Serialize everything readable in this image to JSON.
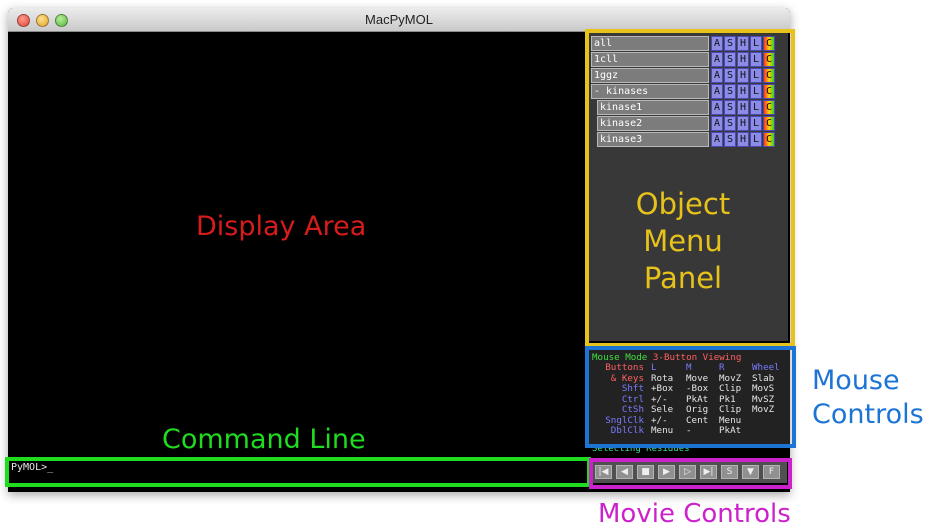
{
  "window": {
    "title": "MacPyMOL"
  },
  "objects": [
    {
      "name": "all",
      "indent": 0
    },
    {
      "name": "1cll",
      "indent": 0
    },
    {
      "name": "1ggz",
      "indent": 0
    },
    {
      "name": "- kinases",
      "indent": 0
    },
    {
      "name": "kinase1",
      "indent": 1
    },
    {
      "name": "kinase2",
      "indent": 1
    },
    {
      "name": "kinase3",
      "indent": 1
    }
  ],
  "object_buttons": [
    "A",
    "S",
    "H",
    "L",
    "C"
  ],
  "mouse_panel": {
    "mode_label": "Mouse Mode",
    "mode_value": "3-Button Viewing",
    "rows": [
      [
        "Buttons",
        "L",
        "M",
        "R",
        "Wheel"
      ],
      [
        "& Keys",
        "Rota",
        "Move",
        "MovZ",
        "Slab"
      ],
      [
        "Shft",
        "+Box",
        "-Box",
        "Clip",
        "MovS"
      ],
      [
        "Ctrl",
        "+/-",
        "PkAt",
        "Pk1",
        "MvSZ"
      ],
      [
        "CtSh",
        "Sele",
        "Orig",
        "Clip",
        "MovZ"
      ],
      [
        "SnglClk",
        "+/-",
        "Cent",
        "Menu",
        ""
      ],
      [
        "DblClk",
        "Menu",
        "-",
        "PkAt",
        ""
      ]
    ]
  },
  "status_text": "Selecting Residues",
  "command_line": {
    "prompt": "PyMOL>_"
  },
  "movie_buttons": [
    "|◀",
    "◀",
    "■",
    "▶",
    "▷",
    "▶|",
    "S",
    "▼",
    "F"
  ],
  "annotations": {
    "display_area": "Display Area",
    "object_menu_panel": "Object\nMenu\nPanel",
    "mouse_controls": "Mouse\nControls",
    "command_line": "Command Line",
    "movie_controls": "Movie Controls"
  },
  "colors": {
    "display_area": "#d81b1b",
    "object_menu_panel": "#e6c21a",
    "mouse_controls": "#1c74d4",
    "command_line": "#1fdc1f",
    "movie_controls": "#cc22cc"
  }
}
